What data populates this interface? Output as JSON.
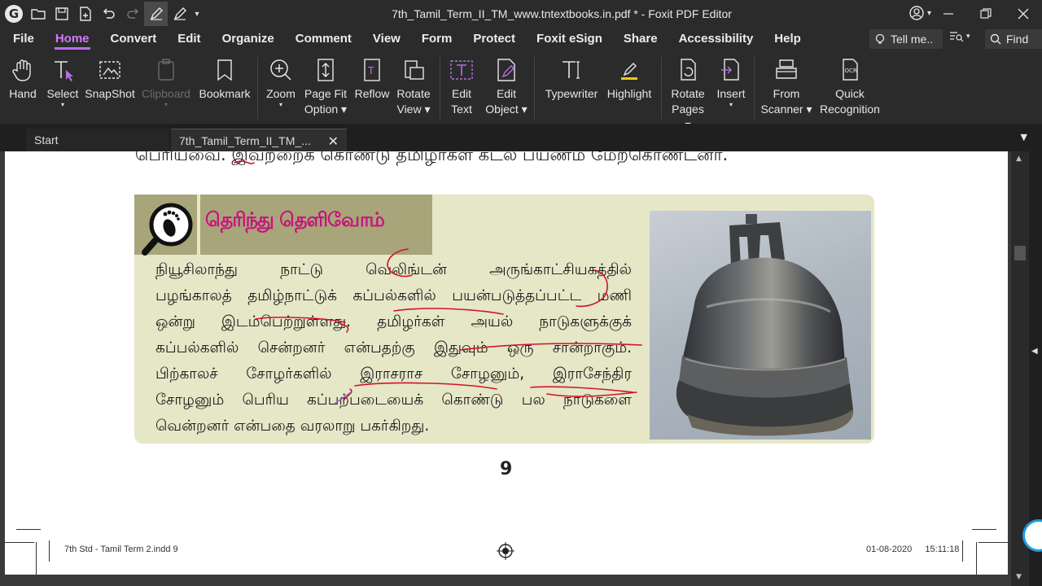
{
  "window": {
    "title": "7th_Tamil_Term_II_TM_www.tntextbooks.in.pdf * - Foxit PDF Editor"
  },
  "menu": {
    "items": [
      "File",
      "Home",
      "Convert",
      "Edit",
      "Organize",
      "Comment",
      "View",
      "Form",
      "Protect",
      "Foxit eSign",
      "Share",
      "Accessibility",
      "Help"
    ],
    "active": "Home",
    "tell_me": "Tell me..",
    "find": "Find"
  },
  "ribbon": {
    "hand": "Hand",
    "select": "Select",
    "snapshot": "SnapShot",
    "clipboard": "Clipboard",
    "bookmark": "Bookmark",
    "zoom": "Zoom",
    "page_fit_1": "Page Fit",
    "page_fit_2": "Option",
    "reflow": "Reflow",
    "rotate_view_1": "Rotate",
    "rotate_view_2": "View",
    "edit_text_1": "Edit",
    "edit_text_2": "Text",
    "edit_object_1": "Edit",
    "edit_object_2": "Object",
    "typewriter": "Typewriter",
    "highlight": "Highlight",
    "rotate_pages_1": "Rotate",
    "rotate_pages_2": "Pages",
    "insert": "Insert",
    "from_scanner_1": "From",
    "from_scanner_2": "Scanner",
    "quick_recognition_1": "Quick",
    "quick_recognition_2": "Recognition"
  },
  "tabs": {
    "start": "Start",
    "document": "7th_Tamil_Term_II_TM_..."
  },
  "page": {
    "top_line": "பெரியவை. இவற்றைக் கொண்டு தமிழர்கள் கடல் பயணம் மேற்கொண்டனர்.",
    "box_title": "தெரிந்து தெளிவோம்",
    "paragraph": [
      "நியூசிலாந்து நாட்டு வெலிங்டன் அருங்காட்சியகத்தில்",
      "பழங்காலத் தமிழ்நாட்டுக் கப்பல்களில் பயன்படுத்தப்பட்ட மணி",
      "ஒன்று இடம்பெற்றுள்ளது. தமிழர்கள் அயல் நாடுகளுக்குக்",
      "கப்பல்களில் சென்றனர் என்பதற்கு இதுவும் ஒரு சான்றாகும்.",
      "பிற்காலச் சோழர்களில் இராசராச சோழனும், இராசேந்திர",
      "சோழனும் பெரிய கப்பற்படையைக் கொண்டு பல நாடுகளை",
      "வென்றனர் என்பதை வரலாறு பகர்கிறது."
    ],
    "page_number": "9",
    "footer_left": "7th Std - Tamil Term 2.indd   9",
    "footer_date": "01-08-2020",
    "footer_time": "15:11:18"
  },
  "colors": {
    "accent": "#c06cf5",
    "title_magenta": "#c8127e",
    "panel_bg": "#e5e7c7",
    "header_olive": "#a8a57a",
    "annotation_red": "#d4122a"
  }
}
